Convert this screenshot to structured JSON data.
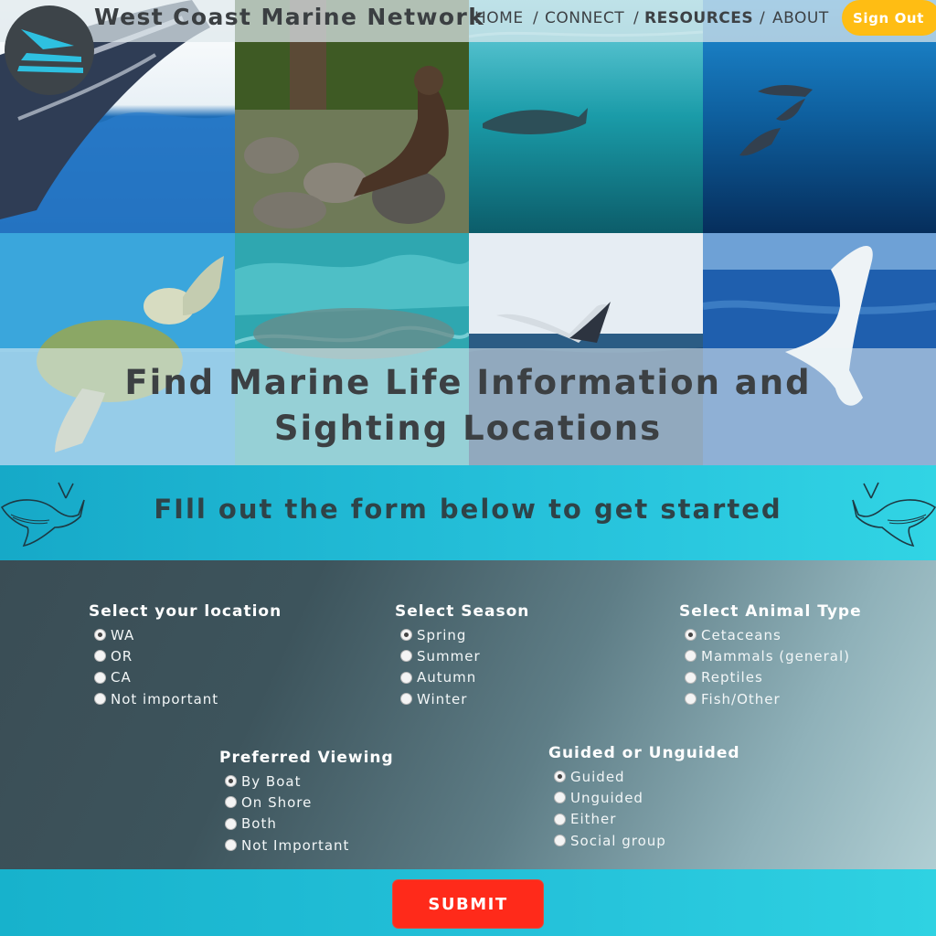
{
  "header": {
    "site_title": "West Coast Marine Network",
    "nav": [
      {
        "label": "HOME",
        "active": false
      },
      {
        "label": "CONNECT",
        "active": false
      },
      {
        "label": "RESOURCES",
        "active": true
      },
      {
        "label": "ABOUT",
        "active": false
      }
    ],
    "separator": "/",
    "sign_out": "Sign Out"
  },
  "hero": {
    "title_line1": "Find Marine Life Information and",
    "title_line2": "Sighting Locations",
    "images": [
      "humpback-whale-fin-image",
      "river-otter-image",
      "whale-shark-image",
      "dolphins-image",
      "sea-turtle-image",
      "seal-swimming-image",
      "whale-breach-image",
      "whale-tail-image"
    ]
  },
  "intro": {
    "text": "FIll out the form below to get started",
    "icons": [
      "whale-outline-icon",
      "whale-outline-icon"
    ]
  },
  "form": {
    "location": {
      "title": "Select your location",
      "options": [
        "WA",
        "OR",
        "CA",
        "Not important"
      ],
      "selected": 0
    },
    "season": {
      "title": "Select Season",
      "options": [
        "Spring",
        "Summer",
        "Autumn",
        "Winter"
      ],
      "selected": 0
    },
    "animal": {
      "title": "Select Animal Type",
      "options": [
        "Cetaceans",
        "Mammals (general)",
        "Reptiles",
        "Fish/Other"
      ],
      "selected": 0
    },
    "viewing": {
      "title": "Preferred Viewing",
      "options": [
        "By Boat",
        "On Shore",
        "Both",
        "Not Important"
      ],
      "selected": 0
    },
    "guided": {
      "title": "Guided or Unguided",
      "options": [
        "Guided",
        "Unguided",
        "Either",
        "Social group"
      ],
      "selected": 0
    }
  },
  "submit": {
    "label": "SUBMIT"
  },
  "colors": {
    "accent": "#ffbd13",
    "submit": "#ff2a1a",
    "teal": "#22bcd6",
    "form_dark": "#3a4d55"
  }
}
